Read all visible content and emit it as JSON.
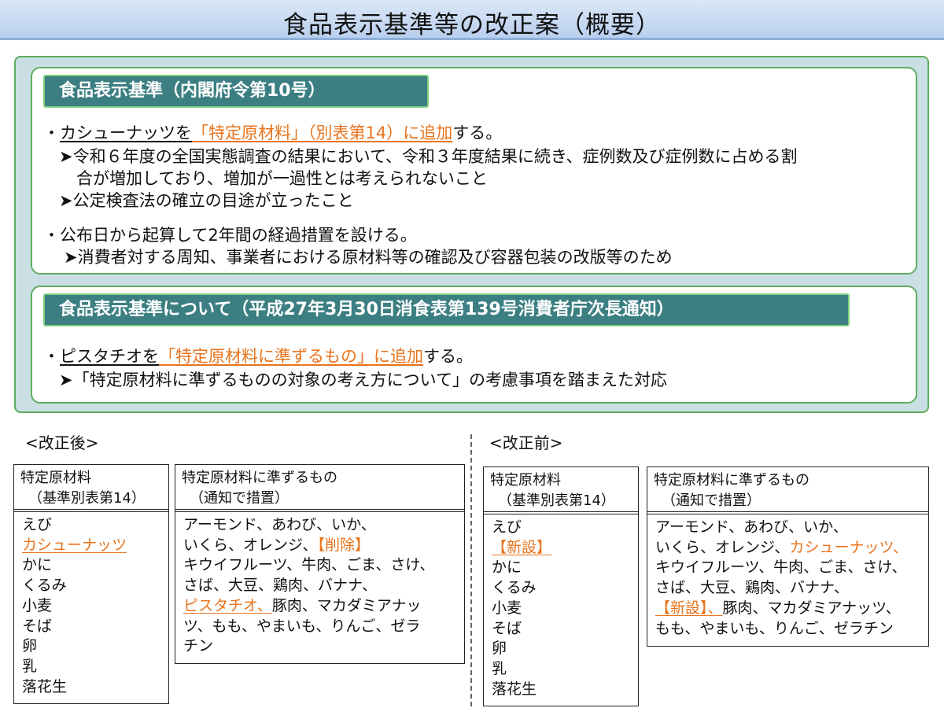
{
  "page": {
    "title": "食品表示基準等の改正案（概要）"
  },
  "section1": {
    "header": "食品表示基準（内閣府令第10号）",
    "bullet1_prefix": "・",
    "bullet1_underlined": "カシューナッツを",
    "bullet1_orange": "「特定原材料」（別表第14）に追加",
    "bullet1_suffix": "する。",
    "sub1_line1": "➤令和６年度の全国実態調査の結果において、令和３年度結果に続き、症例数及び症例数に占める割",
    "sub1_line2": "合が増加しており、増加が一過性とは考えられないこと",
    "sub2": "➤公定検査法の確立の目途が立ったこと",
    "bullet2": "・公布日から起算して2年間の経過措置を設ける。",
    "sub3": "➤消費者対する周知、事業者における原材料等の確認及び容器包装の改版等のため"
  },
  "section2": {
    "header": "食品表示基準について（平成27年3月30日消食表第139号消費者庁次長通知）",
    "bullet_prefix": "・",
    "bullet_underlined": "ピスタチオを",
    "bullet_orange": "「特定原材料に準ずるもの」に追加",
    "bullet_suffix": "する。",
    "sub": "➤「特定原材料に準ずるものの対象の考え方について」の考慮事項を踏まえた対応"
  },
  "after": {
    "label": "<改正後>",
    "box1": {
      "header_line1": "特定原材料",
      "header_line2": "（基準別表第14）",
      "items": [
        "えび",
        "カシューナッツ",
        "かに",
        "くるみ",
        "小麦",
        "そば",
        "卵",
        "乳",
        "落花生"
      ]
    },
    "box2": {
      "header_line1": "特定原材料に準ずるもの",
      "header_line2": "（通知で措置）",
      "line1": "アーモンド、あわび、いか、",
      "line2_a": "いくら、オレンジ、",
      "line2_b": "【削除】",
      "line3": "キウイフルーツ、牛肉、ごま、さけ、",
      "line4": "さば、大豆、鶏肉、バナナ、",
      "line5_a": "ピスタチオ、",
      "line5_b": "豚肉、マカダミアナッ",
      "line6": "ツ、もも、やまいも、りんご、ゼラ",
      "line7": "チン"
    }
  },
  "before": {
    "label": "<改正前>",
    "box1": {
      "header_line1": "特定原材料",
      "header_line2": "（基準別表第14）",
      "items": [
        "えび",
        "【新設】",
        "かに",
        "くるみ",
        "小麦",
        "そば",
        "卵",
        "乳",
        "落花生"
      ]
    },
    "box2": {
      "header_line1": "特定原材料に準ずるもの",
      "header_line2": "（通知で措置）",
      "line1": "アーモンド、あわび、いか、",
      "line2_a": "いくら、オレンジ、",
      "line2_b": "カシューナッツ、",
      "line3": "キウイフルーツ、牛肉、ごま、さけ、",
      "line4": "さば、大豆、鶏肉、バナナ、",
      "line5_a": "【新設】、",
      "line5_b": "豚肉、マカダミアナッツ、",
      "line6": "もも、やまいも、りんご、ゼラチン"
    }
  },
  "colors": {
    "accent_orange": "#e8731c",
    "header_teal": "#3c7f83",
    "frame_green": "#5fae5f"
  }
}
